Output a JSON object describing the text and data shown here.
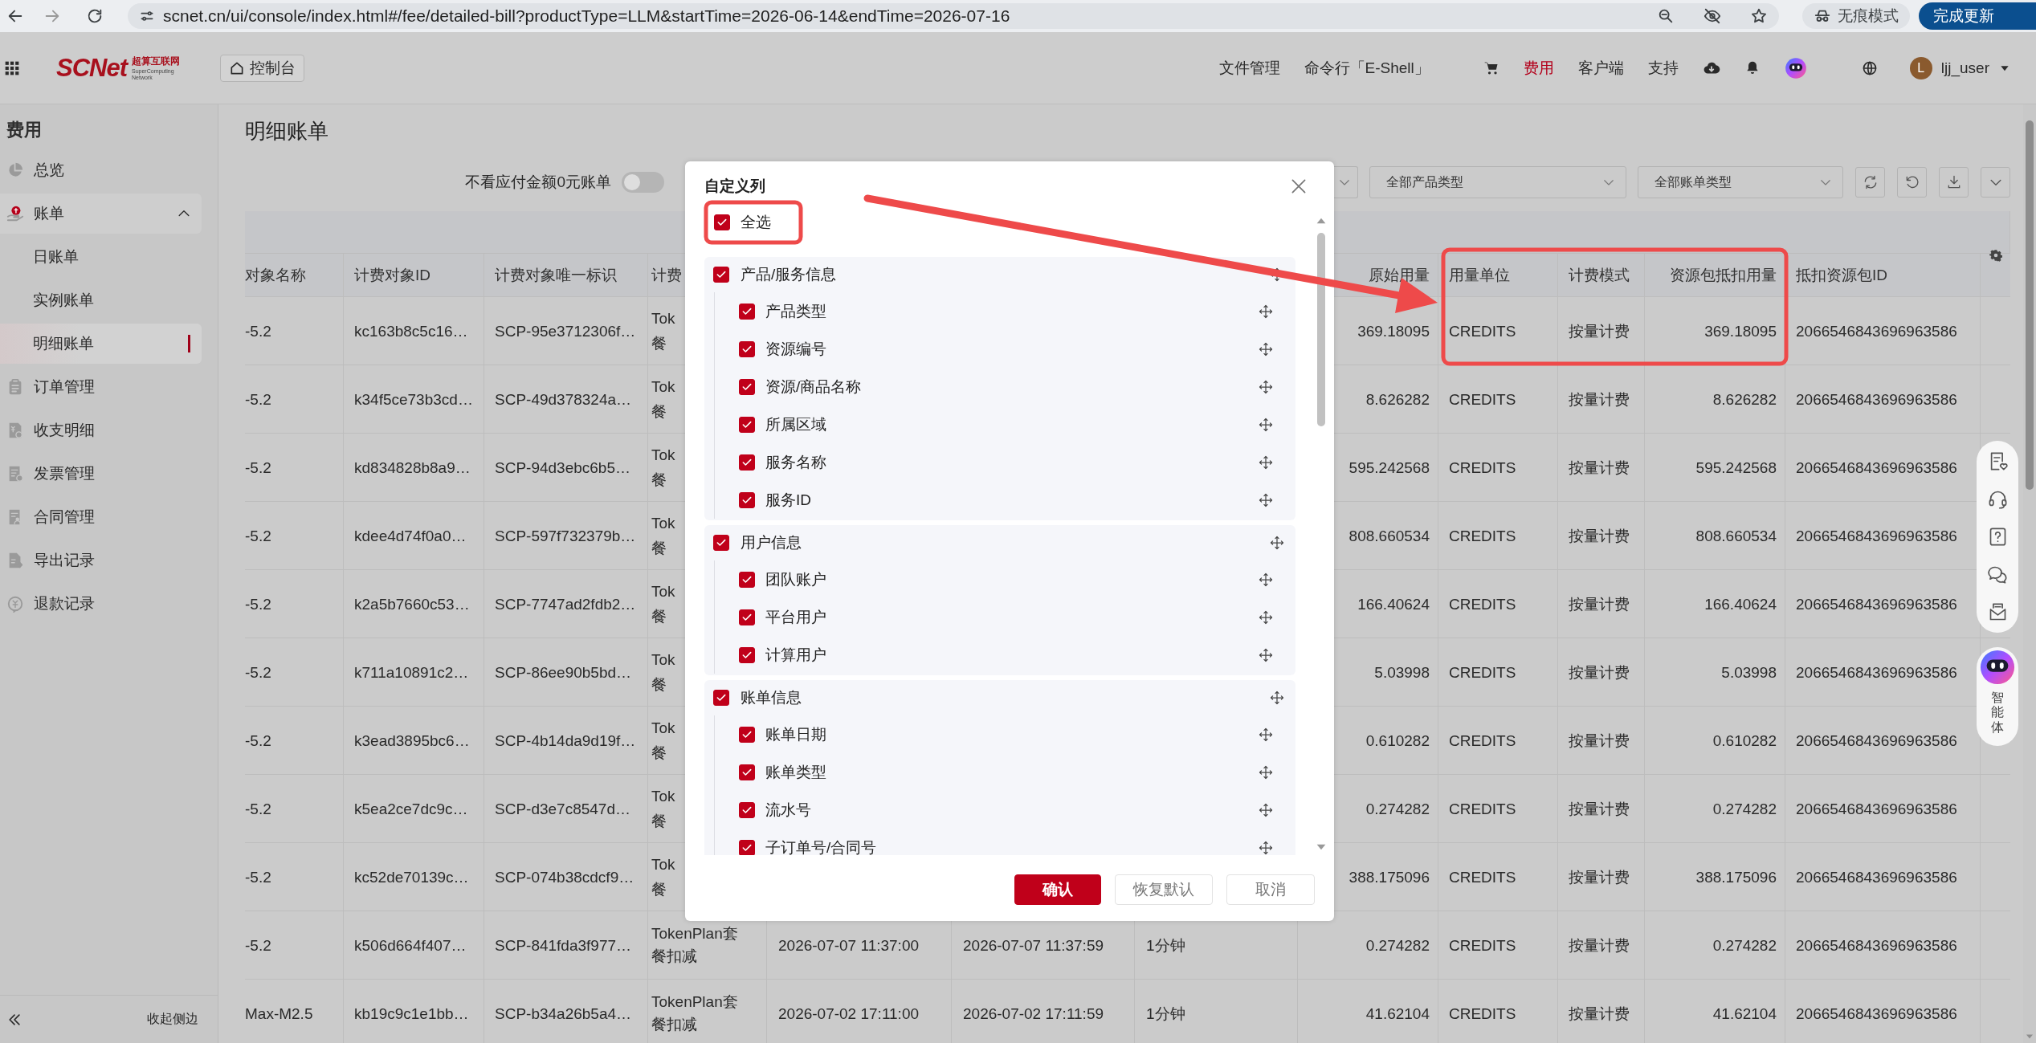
{
  "browser": {
    "url": "scnet.cn/ui/console/index.html#/fee/detailed-bill?productType=LLM&startTime=2026-06-14&endTime=2026-07-16",
    "incognito_label": "无痕模式",
    "update_button": "完成更新"
  },
  "header": {
    "logo": {
      "wordmark": "SCNet",
      "name": "超算互联网",
      "tagline": "SuperComputing Network"
    },
    "console_button": "控制台",
    "nav": [
      {
        "label": "文件管理",
        "selected": false
      },
      {
        "label": "命令行「E-Shell」",
        "selected": false
      },
      {
        "label": "费用",
        "selected": true
      },
      {
        "label": "客户端",
        "selected": false
      },
      {
        "label": "支持",
        "selected": false
      }
    ],
    "user": {
      "avatar_initial": "L",
      "name": "ljj_user"
    }
  },
  "sidebar": {
    "title": "费用",
    "items": [
      {
        "label": "总览",
        "selected": false
      },
      {
        "label": "账单",
        "selected": false,
        "expanded": true,
        "children": [
          {
            "label": "日账单",
            "selected": false
          },
          {
            "label": "实例账单",
            "selected": false
          },
          {
            "label": "明细账单",
            "selected": true
          }
        ]
      },
      {
        "label": "订单管理",
        "selected": false
      },
      {
        "label": "收支明细",
        "selected": false
      },
      {
        "label": "发票管理",
        "selected": false
      },
      {
        "label": "合同管理",
        "selected": false
      },
      {
        "label": "导出记录",
        "selected": false
      },
      {
        "label": "退款记录",
        "selected": false
      }
    ],
    "collapse_label": "收起侧边"
  },
  "page_title": "明细账单",
  "filters": {
    "hide_zero_payable": {
      "label": "不看应付金额0元账单",
      "on": false
    },
    "product_type": "全部产品类型",
    "bill_type": "全部账单类型"
  },
  "table": {
    "columns": {
      "object_name": "对象名称",
      "object_id": "计费对象ID",
      "unique_id": "计费对象唯一标识",
      "column_4": "计费",
      "raw_usage": "原始用量",
      "usage_unit": "用量单位",
      "billing_mode": "计费模式",
      "package_deduction": "资源包抵扣用量",
      "package_id": "抵扣资源包ID"
    },
    "rows": [
      {
        "object_name": "-5.2",
        "object_id": "kc163b8c5c16…",
        "unique_id": "SCP-95e3712306f…",
        "column_4": [
          "Tok",
          "餐"
        ],
        "raw_usage": "369.18095",
        "usage_unit": "CREDITS",
        "billing_mode": "按量计费",
        "package_deduction": "369.18095",
        "package_id": "2066546843696963586"
      },
      {
        "object_name": "-5.2",
        "object_id": "k34f5ce73b3cd…",
        "unique_id": "SCP-49d378324a…",
        "column_4": [
          "Tok",
          "餐"
        ],
        "raw_usage": "8.626282",
        "usage_unit": "CREDITS",
        "billing_mode": "按量计费",
        "package_deduction": "8.626282",
        "package_id": "2066546843696963586"
      },
      {
        "object_name": "-5.2",
        "object_id": "kd834828b8a9…",
        "unique_id": "SCP-94d3ebc6b5…",
        "column_4": [
          "Tok",
          "餐"
        ],
        "raw_usage": "595.242568",
        "usage_unit": "CREDITS",
        "billing_mode": "按量计费",
        "package_deduction": "595.242568",
        "package_id": "2066546843696963586"
      },
      {
        "object_name": "-5.2",
        "object_id": "kdee4d74f0a0…",
        "unique_id": "SCP-597f732379b…",
        "column_4": [
          "Tok",
          "餐"
        ],
        "raw_usage": "808.660534",
        "usage_unit": "CREDITS",
        "billing_mode": "按量计费",
        "package_deduction": "808.660534",
        "package_id": "2066546843696963586"
      },
      {
        "object_name": "-5.2",
        "object_id": "k2a5b7660c53…",
        "unique_id": "SCP-7747ad2fdb2…",
        "column_4": [
          "Tok",
          "餐"
        ],
        "raw_usage": "166.40624",
        "usage_unit": "CREDITS",
        "billing_mode": "按量计费",
        "package_deduction": "166.40624",
        "package_id": "2066546843696963586"
      },
      {
        "object_name": "-5.2",
        "object_id": "k711a10891c2…",
        "unique_id": "SCP-86ee90b5bd…",
        "column_4": [
          "Tok",
          "餐"
        ],
        "raw_usage": "5.03998",
        "usage_unit": "CREDITS",
        "billing_mode": "按量计费",
        "package_deduction": "5.03998",
        "package_id": "2066546843696963586"
      },
      {
        "object_name": "-5.2",
        "object_id": "k3ead3895bc6…",
        "unique_id": "SCP-4b14da9d19f…",
        "column_4": [
          "Tok",
          "餐"
        ],
        "raw_usage": "0.610282",
        "usage_unit": "CREDITS",
        "billing_mode": "按量计费",
        "package_deduction": "0.610282",
        "package_id": "2066546843696963586"
      },
      {
        "object_name": "-5.2",
        "object_id": "k5ea2ce7dc9c…",
        "unique_id": "SCP-d3e7c8547d…",
        "column_4": [
          "Tok",
          "餐"
        ],
        "raw_usage": "0.274282",
        "usage_unit": "CREDITS",
        "billing_mode": "按量计费",
        "package_deduction": "0.274282",
        "package_id": "2066546843696963586"
      },
      {
        "object_name": "-5.2",
        "object_id": "kc52de70139c…",
        "unique_id": "SCP-074b38cdcf9…",
        "column_4": [
          "Tok",
          "餐"
        ],
        "raw_usage": "388.175096",
        "usage_unit": "CREDITS",
        "billing_mode": "按量计费",
        "package_deduction": "388.175096",
        "package_id": "2066546843696963586"
      },
      {
        "object_name": "-5.2",
        "object_id": "k506d664f407…",
        "unique_id": "SCP-841fda3f977…",
        "column_4": "TokenPlan套餐扣减",
        "column_5": "2026-07-07 11:37:00",
        "column_6": "2026-07-07 11:37:59",
        "column_7": "1分钟",
        "raw_usage": "0.274282",
        "usage_unit": "CREDITS",
        "billing_mode": "按量计费",
        "package_deduction": "0.274282",
        "package_id": "2066546843696963586"
      },
      {
        "object_name": "Max-M2.5",
        "object_id": "kb19c9c1e1bb…",
        "unique_id": "SCP-b34a26b5a4…",
        "column_4": "TokenPlan套餐扣减",
        "column_5": "2026-07-02 17:11:00",
        "column_6": "2026-07-02 17:11:59",
        "column_7": "1分钟",
        "raw_usage": "41.62104",
        "usage_unit": "CREDITS",
        "billing_mode": "按量计费",
        "package_deduction": "41.62104",
        "package_id": "2066546843696963586"
      }
    ]
  },
  "column_dialog": {
    "title": "自定义列",
    "select_all": {
      "label": "全选",
      "checked": true
    },
    "groups": [
      {
        "label": "产品/服务信息",
        "checked": true,
        "children": [
          {
            "label": "产品类型",
            "checked": true
          },
          {
            "label": "资源编号",
            "checked": true
          },
          {
            "label": "资源/商品名称",
            "checked": true
          },
          {
            "label": "所属区域",
            "checked": true
          },
          {
            "label": "服务名称",
            "checked": true
          },
          {
            "label": "服务ID",
            "checked": true
          }
        ]
      },
      {
        "label": "用户信息",
        "checked": true,
        "children": [
          {
            "label": "团队账户",
            "checked": true
          },
          {
            "label": "平台用户",
            "checked": true
          },
          {
            "label": "计算用户",
            "checked": true
          }
        ]
      },
      {
        "label": "账单信息",
        "checked": true,
        "children": [
          {
            "label": "账单日期",
            "checked": true
          },
          {
            "label": "账单类型",
            "checked": true
          },
          {
            "label": "流水号",
            "checked": true
          },
          {
            "label": "子订单号/合同号",
            "checked": true
          }
        ]
      }
    ],
    "buttons": [
      {
        "label": "确认",
        "kind": "primary"
      },
      {
        "label": "恢复默认",
        "kind": "default"
      },
      {
        "label": "取消",
        "kind": "default"
      }
    ]
  },
  "assistant": {
    "label": "智能体"
  }
}
